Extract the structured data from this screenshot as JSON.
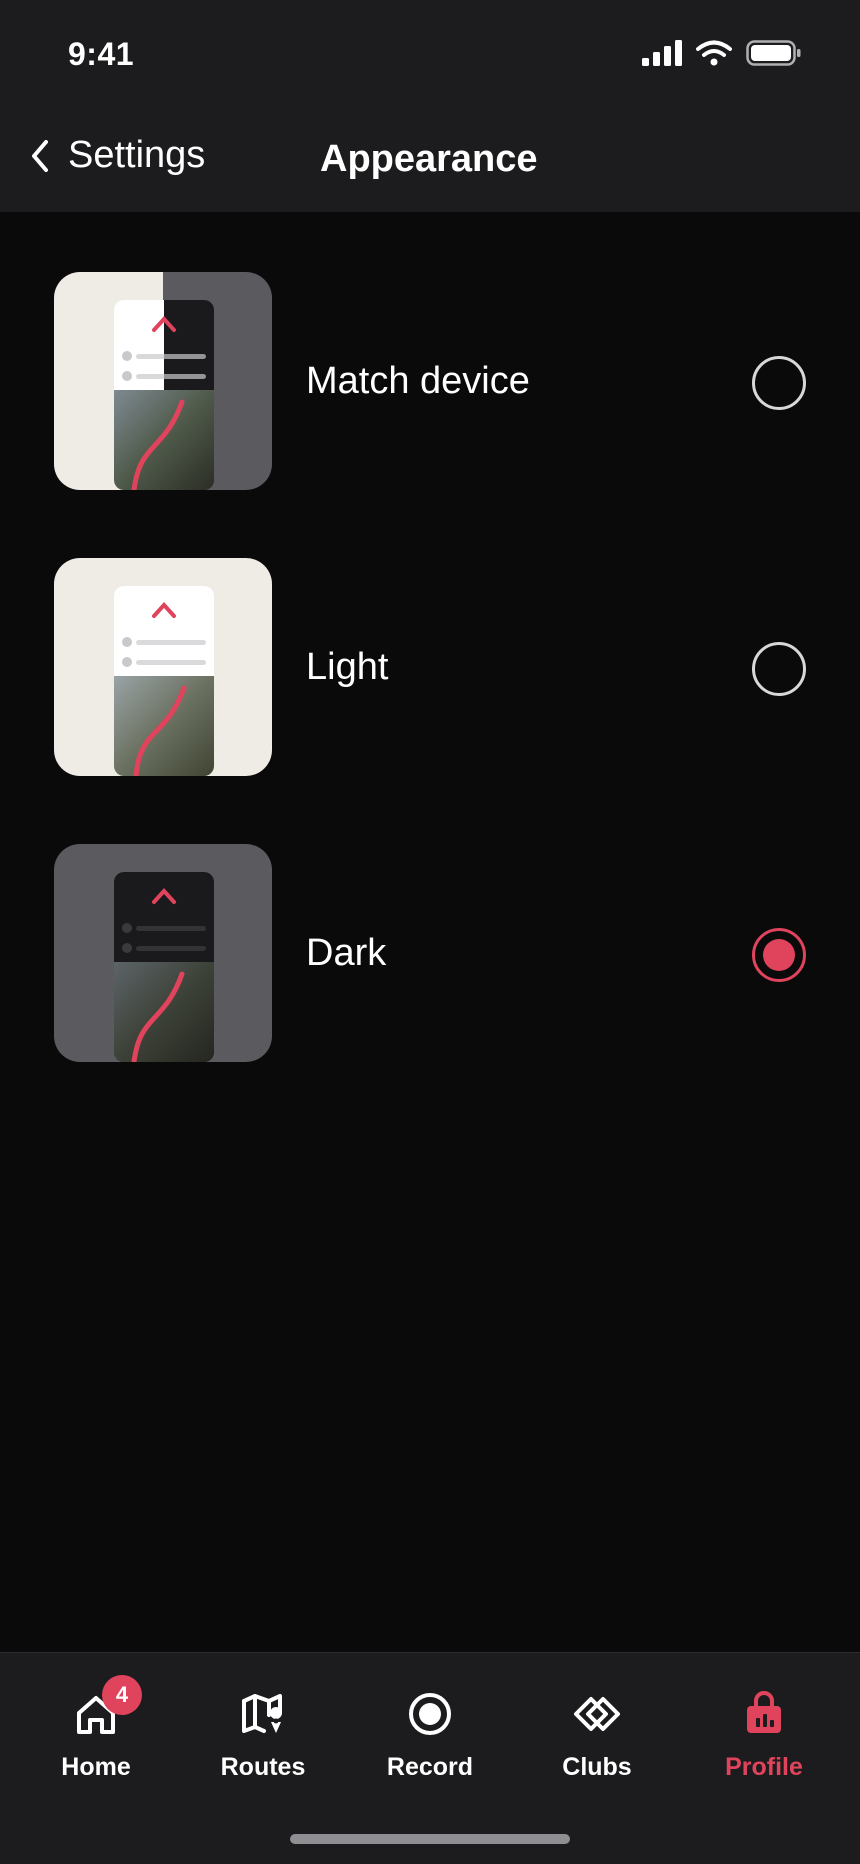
{
  "status": {
    "time": "9:41"
  },
  "nav": {
    "back_label": "Settings",
    "title": "Appearance"
  },
  "options": [
    {
      "label": "Match device",
      "selected": false,
      "thumb": "split-light-dark-preview"
    },
    {
      "label": "Light",
      "selected": false,
      "thumb": "light-preview"
    },
    {
      "label": "Dark",
      "selected": true,
      "thumb": "dark-preview"
    }
  ],
  "tabs": [
    {
      "label": "Home",
      "icon": "home-icon",
      "badge": "4",
      "active": false
    },
    {
      "label": "Routes",
      "icon": "map-pin-icon",
      "active": false
    },
    {
      "label": "Record",
      "icon": "record-icon",
      "active": false
    },
    {
      "label": "Clubs",
      "icon": "clubs-icon",
      "active": false
    },
    {
      "label": "Profile",
      "icon": "shopping-bag-icon",
      "active": true
    }
  ],
  "colors": {
    "accent": "#e0435c",
    "background": "#0a0a0b",
    "bar": "#1c1c1e"
  }
}
